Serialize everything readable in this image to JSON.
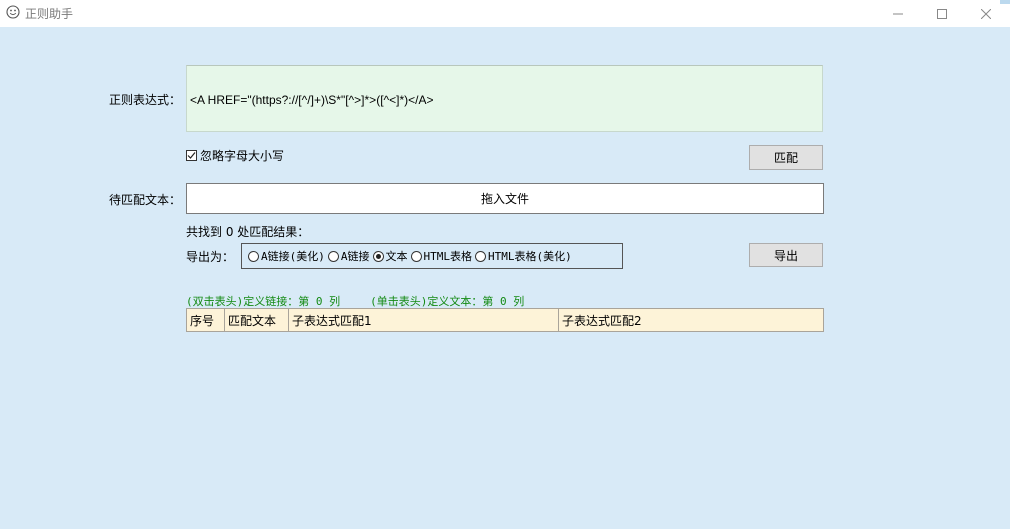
{
  "window": {
    "title": "正则助手",
    "icon": "smiley-icon",
    "controls": [
      "minimize",
      "maximize",
      "close"
    ]
  },
  "regex": {
    "label": "正则表达式：",
    "value": "<A HREF=\"(https?://[^/]+)\\S*\"[^>]*>([^<]*)</A>"
  },
  "ignore_case": {
    "label": "忽略字母大小写",
    "checked": true
  },
  "match_button": "匹配",
  "source": {
    "label": "待匹配文本：",
    "drop_text": "拖入文件"
  },
  "result_summary": "共找到 0 处匹配结果：",
  "export": {
    "label": "导出为：",
    "options": [
      "A链接(美化)",
      "A链接",
      "文本",
      "HTML表格",
      "HTML表格(美化)"
    ],
    "selected": "文本",
    "button": "导出"
  },
  "hints": {
    "link": "(双击表头)定义链接：第 0 列",
    "text": "(单击表头)定义文本：第 0 列"
  },
  "table": {
    "columns": [
      "序号",
      "匹配文本",
      "子表达式匹配1",
      "子表达式匹配2"
    ]
  },
  "colors": {
    "client_bg": "#d8eaf7",
    "regex_bg": "#e6f7e9",
    "table_header_bg": "#fdf3d8",
    "hint_green": "#138a13"
  }
}
